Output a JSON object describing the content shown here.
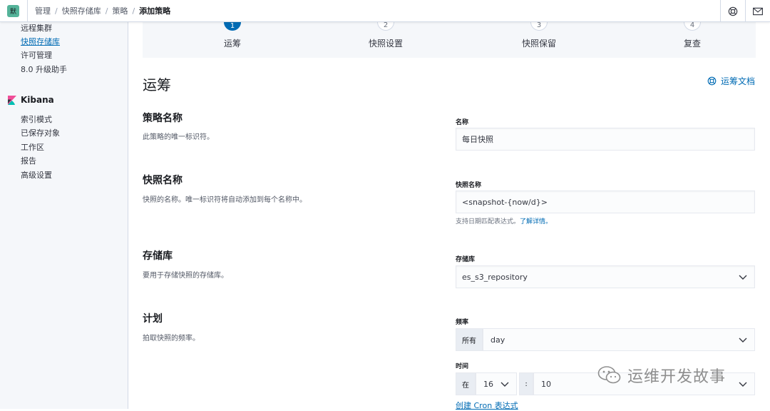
{
  "header": {
    "avatar_initial": "默",
    "breadcrumbs": [
      "管理",
      "快照存储库",
      "策略",
      "添加策略"
    ],
    "help_icon": "lifebuoy-icon",
    "mail_icon": "mail-icon"
  },
  "sidebar": {
    "items_top": [
      {
        "label": "远程集群",
        "active": false
      },
      {
        "label": "快照存储库",
        "active": true
      },
      {
        "label": "许可管理",
        "active": false
      },
      {
        "label": "8.0 升级助手",
        "active": false
      }
    ],
    "kibana_section": {
      "title": "Kibana",
      "items": [
        "索引模式",
        "已保存对象",
        "工作区",
        "报告",
        "高级设置"
      ]
    }
  },
  "steps": [
    {
      "number": "1",
      "label": "运筹",
      "active": true
    },
    {
      "number": "2",
      "label": "快照设置",
      "active": false
    },
    {
      "number": "3",
      "label": "快照保留",
      "active": false
    },
    {
      "number": "4",
      "label": "复查",
      "active": false
    }
  ],
  "page": {
    "title": "运筹",
    "docs_link": "运筹文档"
  },
  "sections": {
    "policy_name": {
      "title": "策略名称",
      "description": "此策略的唯一标识符。",
      "field_label": "名称",
      "field_value": "每日快照"
    },
    "snapshot_name": {
      "title": "快照名称",
      "description": "快照的名称。唯一标识符将自动添加到每个名称中。",
      "field_label": "快照名称",
      "field_value": "<snapshot-{now/d}>",
      "help_text": "支持日期匹配表达式。",
      "help_link": "了解详情。"
    },
    "repository": {
      "title": "存储库",
      "description": "要用于存储快照的存储库。",
      "field_label": "存储库",
      "field_value": "es_s3_repository"
    },
    "schedule": {
      "title": "计划",
      "description": "拍取快照的频率。",
      "frequency_label": "频率",
      "frequency_prepend": "所有",
      "frequency_value": "day",
      "time_label": "时间",
      "time_prepend": "在",
      "hour_value": "16",
      "separator": ":",
      "minute_value": "10",
      "cron_link": "创建 Cron 表达式"
    }
  },
  "watermark": {
    "text": "运维开发故事",
    "icon": "wechat-icon"
  },
  "colors": {
    "accent": "#006bb4",
    "sidebar_bg": "#f5f7fa",
    "avatar_bg": "#54b399"
  }
}
